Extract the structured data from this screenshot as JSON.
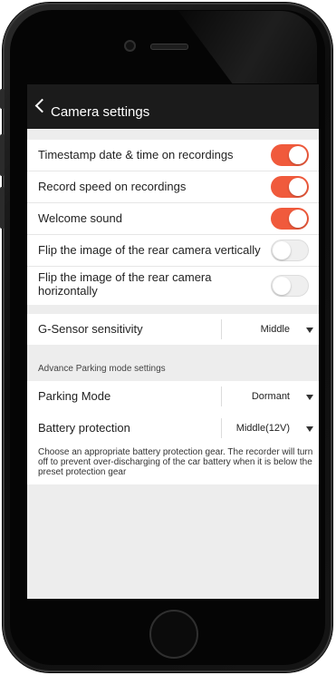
{
  "header": {
    "title": "Camera settings"
  },
  "toggles": [
    {
      "label": "Timestamp date & time on recordings",
      "state": "on"
    },
    {
      "label": "Record speed on recordings",
      "state": "on"
    },
    {
      "label": "Welcome sound",
      "state": "on"
    },
    {
      "label": "Flip the image of the rear camera vertically",
      "state": "off"
    },
    {
      "label": "Flip the image of the rear camera horizontally",
      "state": "off"
    }
  ],
  "gsensor": {
    "label": "G-Sensor sensitivity",
    "value": "Middle"
  },
  "parking": {
    "section_title": "Advance Parking mode settings",
    "mode": {
      "label": "Parking Mode",
      "value": "Dormant"
    },
    "battery": {
      "label": "Battery protection",
      "value": "Middle(12V)"
    },
    "note": "Choose an appropriate battery protection gear. The recorder will turn off to prevent over-discharging of the car battery when it is below the preset protection gear"
  },
  "colors": {
    "accent": "#f05a3c",
    "navbar": "#1b1b1b"
  }
}
